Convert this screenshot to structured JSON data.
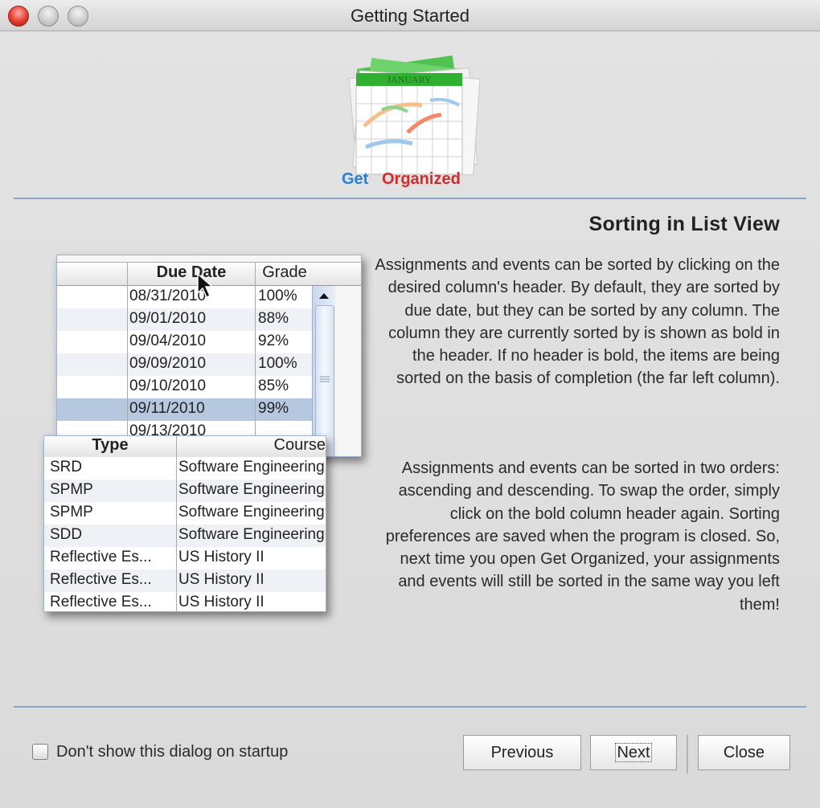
{
  "window": {
    "title": "Getting Started"
  },
  "logo": {
    "calendar_label": "JANUARY",
    "brand_first": "Get",
    "brand_second": "Organized"
  },
  "page": {
    "heading": "Sorting in List View",
    "paragraph1": "Assignments and events can be sorted by clicking on the desired column's header. By default, they are sorted by due date, but they can be sorted by any column. The column they are currently sorted by is shown as bold in the header. If no header is bold, the items are being sorted on the basis of completion (the far left column).",
    "paragraph2": "Assignments and events can be sorted in two orders: ascending and descending. To swap the order, simply click on the bold column header again. Sorting preferences are saved when the program is closed. So, next time you open Get Organized, your assignments and events will still be sorted in the same way you left them!"
  },
  "demo_table1": {
    "headers": [
      "Due Date",
      "Grade"
    ],
    "rows": [
      {
        "due": "08/31/2010",
        "grade": "100%"
      },
      {
        "due": "09/01/2010",
        "grade": "88%"
      },
      {
        "due": "09/04/2010",
        "grade": "92%"
      },
      {
        "due": "09/09/2010",
        "grade": "100%"
      },
      {
        "due": "09/10/2010",
        "grade": "85%"
      },
      {
        "due": "09/11/2010",
        "grade": "99%"
      },
      {
        "due": "09/13/2010",
        "grade": ""
      }
    ]
  },
  "demo_table2": {
    "headers": [
      "Type",
      "Course"
    ],
    "rows": [
      {
        "type": "SRD",
        "course": "Software Engineering"
      },
      {
        "type": "SPMP",
        "course": "Software Engineering"
      },
      {
        "type": "SPMP",
        "course": "Software Engineering"
      },
      {
        "type": "SDD",
        "course": "Software Engineering"
      },
      {
        "type": "Reflective Es...",
        "course": "US History II"
      },
      {
        "type": "Reflective Es...",
        "course": "US History II"
      },
      {
        "type": "Reflective Es...",
        "course": "US History II"
      }
    ]
  },
  "footer": {
    "checkbox_label": "Don't show this dialog on startup",
    "checkbox_checked": false,
    "previous_label": "Previous",
    "next_label": "Next",
    "close_label": "Close"
  }
}
